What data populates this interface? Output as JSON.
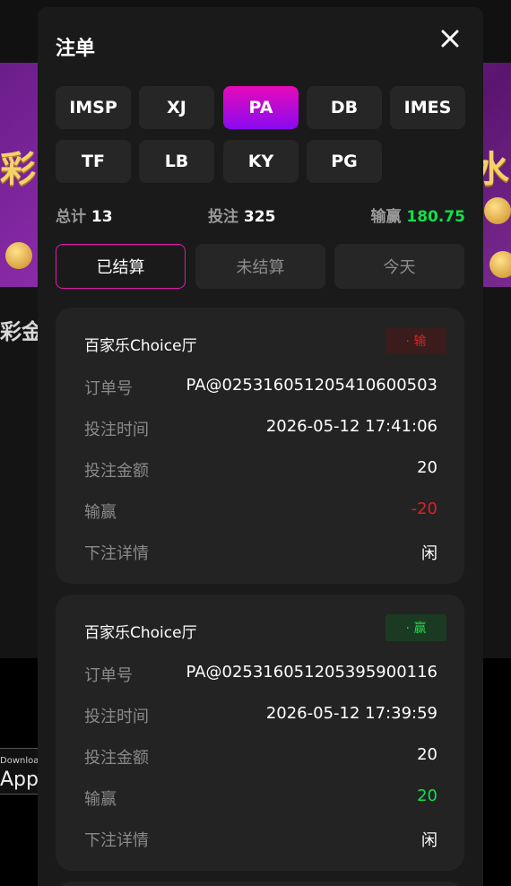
{
  "background": {
    "banner_left_glyph": "彩",
    "banner_right_glyph": "水",
    "side_text": "彩金",
    "store_badge_small": "Downloa",
    "store_badge_big": "App S"
  },
  "modal": {
    "title": "注单",
    "close_icon": "close-icon"
  },
  "providers": [
    "IMSP",
    "XJ",
    "PA",
    "DB",
    "IMES",
    "TF",
    "LB",
    "KY",
    "PG"
  ],
  "active_provider": "PA",
  "summary": {
    "total_label": "总计",
    "total_value": "13",
    "bet_label": "投注",
    "bet_value": "325",
    "winloss_label": "输赢",
    "winloss_value": "180.75"
  },
  "filters": [
    "已结算",
    "未结算",
    "今天"
  ],
  "active_filter": "已结算",
  "orders": [
    {
      "title": "百家乐Choice厅",
      "status": "· 输",
      "status_type": "lose",
      "order_no_label": "订单号",
      "order_no": "PA@025316051205410600503",
      "time_label": "投注时间",
      "time": "2026-05-12 17:41:06",
      "amount_label": "投注金额",
      "amount": "20",
      "winloss_label": "输赢",
      "winloss": "-20",
      "detail_label": "下注详情",
      "detail": "闲"
    },
    {
      "title": "百家乐Choice厅",
      "status": "· 赢",
      "status_type": "win",
      "order_no_label": "订单号",
      "order_no": "PA@025316051205395900116",
      "time_label": "投注时间",
      "time": "2026-05-12 17:39:59",
      "amount_label": "投注金额",
      "amount": "20",
      "winloss_label": "输赢",
      "winloss": "20",
      "detail_label": "下注详情",
      "detail": "闲"
    }
  ],
  "colors": {
    "accent_pink": "#e60ab8",
    "accent_purple": "#8a0af0",
    "win_green": "#11e04a",
    "lose_red": "#e02020"
  }
}
